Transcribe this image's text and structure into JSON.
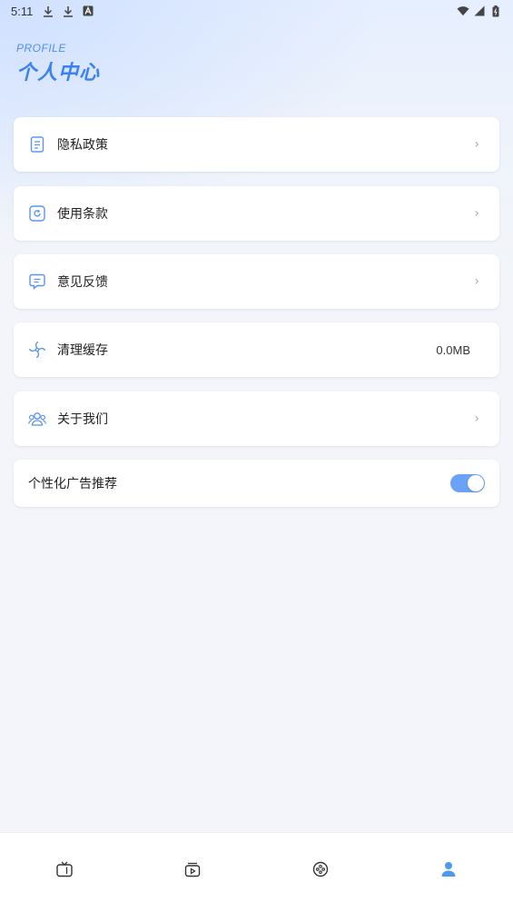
{
  "status_bar": {
    "time": "5:11",
    "left_icons": [
      "download-icon",
      "download-icon",
      "notification-a-icon"
    ],
    "right_icons": [
      "wifi-icon",
      "signal-icon",
      "battery-icon"
    ]
  },
  "header": {
    "subtitle": "PROFILE",
    "title": "个人中心"
  },
  "menu": {
    "items": [
      {
        "label": "隐私政策",
        "icon": "document-icon",
        "trail": "chevron"
      },
      {
        "label": "使用条款",
        "icon": "terms-icon",
        "trail": "chevron"
      },
      {
        "label": "意见反馈",
        "icon": "chat-bubble-icon",
        "trail": "chevron"
      },
      {
        "label": "清理缓存",
        "icon": "fan-icon",
        "value": "0.0MB"
      },
      {
        "label": "关于我们",
        "icon": "users-icon",
        "trail": "chevron"
      }
    ],
    "chevron": "›"
  },
  "ad_toggle": {
    "label": "个性化广告推荐",
    "on": true
  },
  "bottom_nav": {
    "items": [
      "tv-icon",
      "video-box-icon",
      "game-icon",
      "profile-icon"
    ],
    "active_index": 3,
    "colors": {
      "active": "#4a9af0",
      "inactive": "#333333"
    }
  },
  "colors": {
    "accent": "#3b82f0",
    "icon_blue": "#5b95ef",
    "toggle": "#6aa2f7"
  }
}
